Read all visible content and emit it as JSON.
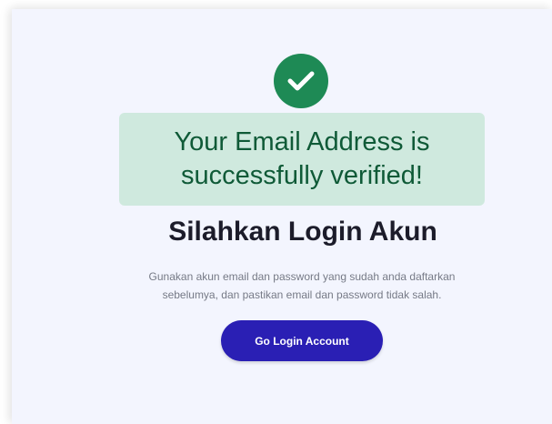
{
  "alert": {
    "message": "Your Email Address is successfully verified!"
  },
  "content": {
    "heading": "Silahkan Login Akun",
    "description": "Gunakan akun email dan password yang sudah anda daftarkan sebelumya, dan pastikan email dan password tidak salah."
  },
  "actions": {
    "login_label": "Go Login Account"
  },
  "colors": {
    "success_icon": "#1e8a55",
    "alert_bg": "#cfe9de",
    "alert_text": "#0f5a37",
    "button_bg": "#2a1fb4",
    "page_bg": "#f3f5fe"
  },
  "icons": {
    "success": "check-circle-icon"
  }
}
